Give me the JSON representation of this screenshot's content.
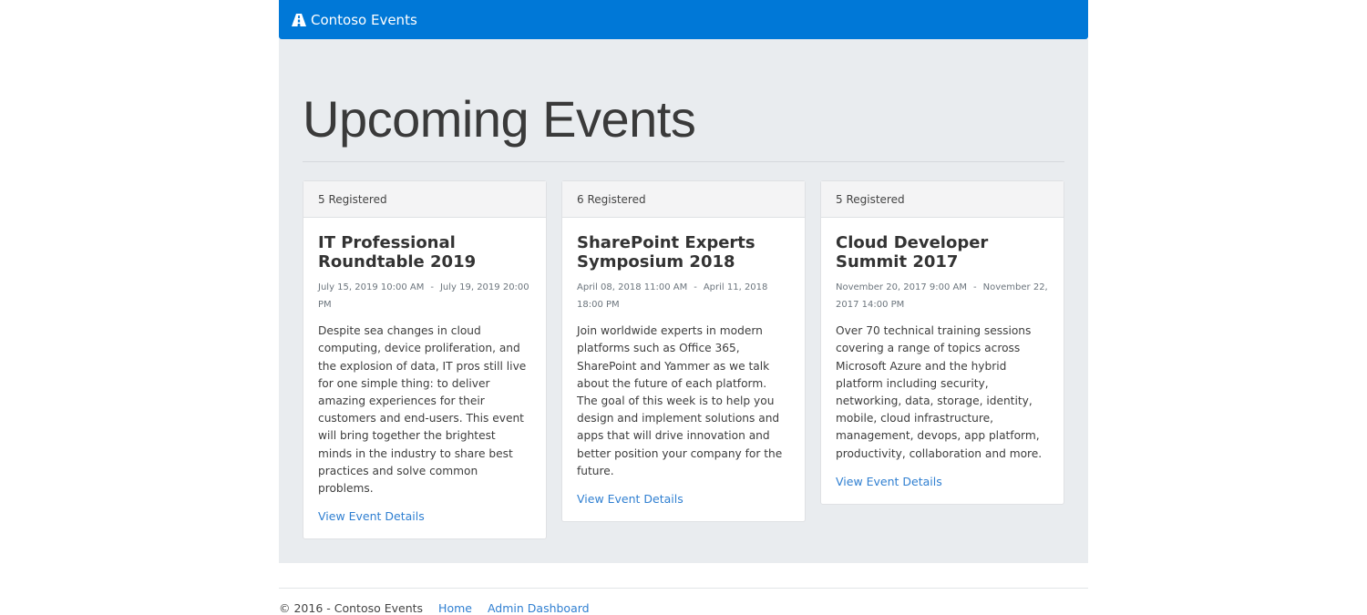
{
  "navbar": {
    "brand_icon": "road-icon",
    "brand_label": "Contoso Events",
    "background": "#0078d7"
  },
  "main": {
    "title": "Upcoming Events",
    "events": [
      {
        "registered": "5 Registered",
        "title": "IT Professional Roundtable 2019",
        "start": "July 15, 2019 10:00 AM",
        "end": "July 19, 2019 20:00 PM",
        "description": "Despite sea changes in cloud computing, device proliferation, and the explosion of data, IT pros still live for one simple thing: to deliver amazing experiences for their customers and end-users. This event will bring together the brightest minds in the industry to share best practices and solve common problems.",
        "link": "View Event Details"
      },
      {
        "registered": "6 Registered",
        "title": "SharePoint Experts Symposium 2018",
        "start": "April 08, 2018 11:00 AM",
        "end": "April 11, 2018 18:00 PM",
        "description": "Join worldwide experts in modern platforms such as Office 365, SharePoint and Yammer as we talk about the future of each platform. The goal of this week is to help you design and implement solutions and apps that will drive innovation and better position your company for the future.",
        "link": "View Event Details"
      },
      {
        "registered": "5 Registered",
        "title": "Cloud Developer Summit 2017",
        "start": "November 20, 2017 9:00 AM",
        "end": "November 22, 2017 14:00 PM",
        "description": "Over 70 technical training sessions covering a range of topics across Microsoft Azure and the hybrid platform including security, networking, data, storage, identity, mobile, cloud infrastructure, management, devops, app platform, productivity, collaboration and more.",
        "link": "View Event Details"
      }
    ]
  },
  "footer": {
    "copyright": "© 2016 - Contoso Events",
    "home": "Home",
    "admin": "Admin Dashboard"
  }
}
